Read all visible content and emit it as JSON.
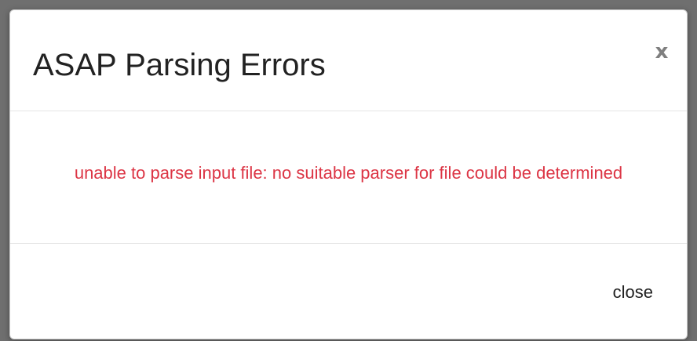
{
  "modal": {
    "title": "ASAP Parsing Errors",
    "close_icon_glyph": "x",
    "close_icon_name": "close-icon",
    "error_message": "unable to parse input file: no suitable parser for file could be determined",
    "footer_close_label": "close"
  },
  "colors": {
    "error_text": "#dc3545",
    "title_text": "#222222",
    "close_icon": "#7f7f7f",
    "backdrop": "#777777"
  }
}
